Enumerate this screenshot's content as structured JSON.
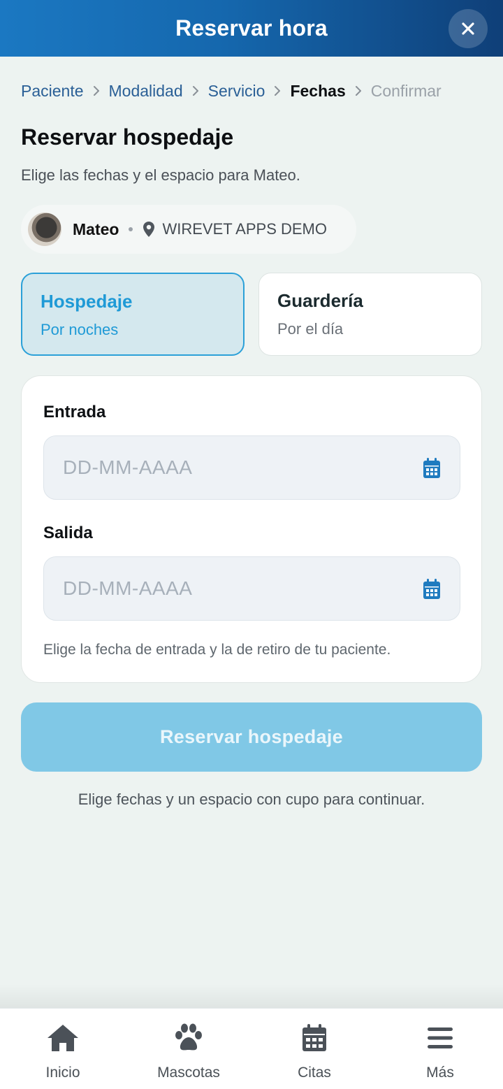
{
  "header": {
    "title": "Reservar hora",
    "close_icon": "close-icon"
  },
  "breadcrumb": {
    "steps": [
      {
        "label": "Paciente",
        "state": "done"
      },
      {
        "label": "Modalidad",
        "state": "done"
      },
      {
        "label": "Servicio",
        "state": "done"
      },
      {
        "label": "Fechas",
        "state": "current"
      },
      {
        "label": "Confirmar",
        "state": "pending"
      }
    ],
    "separator_icon": "chevron-right-icon"
  },
  "page": {
    "title": "Reservar hospedaje",
    "subtitle": "Elige las fechas y el espacio para Mateo."
  },
  "patient_chip": {
    "name": "Mateo",
    "clinic": "WIREVET APPS DEMO",
    "location_icon": "location-pin-icon"
  },
  "options": [
    {
      "title": "Hospedaje",
      "subtitle": "Por noches",
      "selected": true
    },
    {
      "title": "Guardería",
      "subtitle": "Por el día",
      "selected": false
    }
  ],
  "form": {
    "entrada": {
      "label": "Entrada",
      "placeholder": "DD-MM-AAAA",
      "value": ""
    },
    "salida": {
      "label": "Salida",
      "placeholder": "DD-MM-AAAA",
      "value": ""
    },
    "hint": "Elige la fecha de entrada y la de retiro de tu paciente."
  },
  "submit": {
    "label": "Reservar hospedaje",
    "disabled": true
  },
  "footer_hint": "Elige fechas y un espacio con cupo para continuar.",
  "bottom_nav": [
    {
      "label": "Inicio",
      "icon": "home-icon"
    },
    {
      "label": "Mascotas",
      "icon": "paw-icon"
    },
    {
      "label": "Citas",
      "icon": "calendar-icon"
    },
    {
      "label": "Más",
      "icon": "menu-icon"
    }
  ],
  "colors": {
    "accent": "#1f9ad6",
    "header_start": "#1b78c2",
    "header_end": "#0f3f78",
    "button_disabled": "#80c8e6",
    "background": "#edf3f1"
  }
}
